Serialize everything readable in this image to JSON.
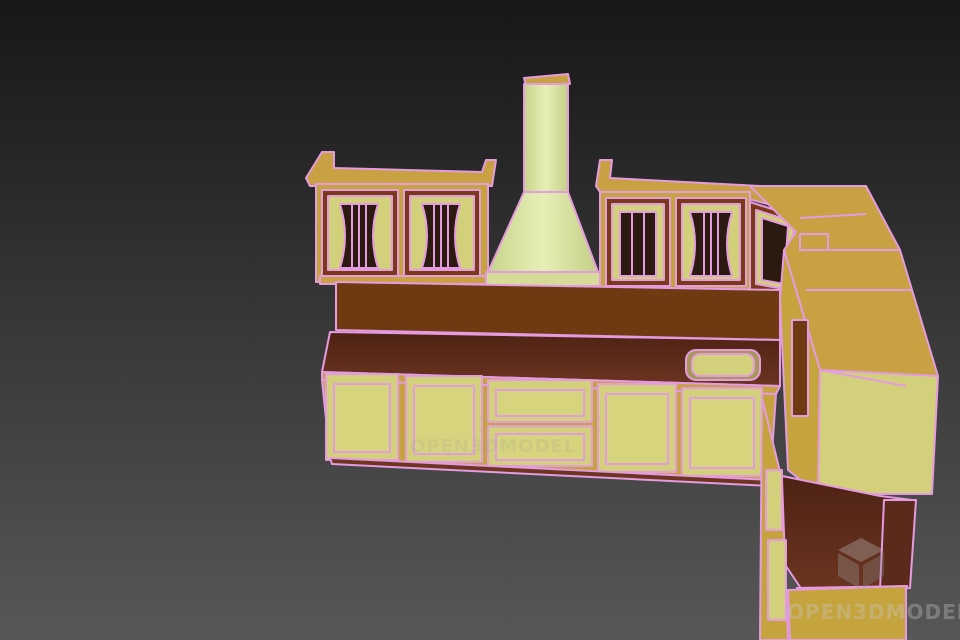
{
  "viewport": {
    "background_top": "#171717",
    "background_bottom": "#565656"
  },
  "model": {
    "wire_color": "#e49be0",
    "face_color": "#d2d07a",
    "top_color": "#c8a242",
    "counter_color": "#5a2a1a",
    "backsplash_color": "#6e3a12",
    "hood_color": "#e2eab0"
  },
  "watermark": {
    "text": "OPEN3DMODEL",
    "center_text": "OPEN3DMODEL"
  }
}
